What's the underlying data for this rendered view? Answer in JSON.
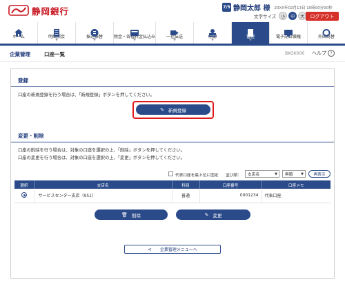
{
  "header": {
    "bank_name": "静岡銀行",
    "user_icon": "7/5",
    "user_name": "静岡太郎 様",
    "login_time": "20XX年02月13日 10時00分00秒",
    "font_size_label": "文字サイズ",
    "font_sizes": [
      "小",
      "中",
      "大"
    ],
    "logout_label": "ログアウト"
  },
  "nav": {
    "items": [
      {
        "label": "ホーム",
        "icon": "home-icon"
      },
      {
        "label": "明細照会",
        "icon": "statement-icon"
      },
      {
        "label": "振込振替",
        "icon": "transfer-icon"
      },
      {
        "label": "税金・各種料金払込み",
        "icon": "tax-payment-icon"
      },
      {
        "label": "一括伝送",
        "icon": "batch-transmission-icon"
      },
      {
        "label": "承認",
        "icon": "approval-icon"
      },
      {
        "label": "管理",
        "icon": "admin-icon"
      },
      {
        "label": "電子記録債権",
        "icon": "electronic-receivables-icon"
      },
      {
        "label": "外国為替",
        "icon": "foreign-exchange-icon"
      }
    ],
    "active_index": 6
  },
  "subheader": {
    "section": "企業管理",
    "page": "口座一覧",
    "screen_id": "BKGK006",
    "help_label": "ヘルプ"
  },
  "register": {
    "title": "登録",
    "description": "口座の新規登録を行う場合は、「新規登録」ボタンを押してください。",
    "new_button": "新規登録"
  },
  "edit": {
    "title": "変更・削除",
    "description_1": "口座の削除を行う場合は、対象の口座を選択の上、「削除」ボタンを押してください。",
    "description_2": "口座の変更を行う場合は、対象の口座を選択の上、「変更」ボタンを押してください。",
    "pin_label": "代表口座を最上位に固定",
    "sort_label": "並び順：",
    "sort_field": "支店名",
    "sort_order": "昇順",
    "redisplay_label": "再表示",
    "columns": [
      "選択",
      "支店名",
      "科目",
      "口座番号",
      "口座メモ"
    ],
    "rows": [
      {
        "branch": "サービスセンター支店（951）",
        "subject": "普通",
        "account_no": "0001234",
        "memo": "代表口座"
      }
    ],
    "delete_button": "削除",
    "change_button": "変更"
  },
  "footer": {
    "back_button": "企業管理メニューへ"
  },
  "colors": {
    "brand": "#2a4a8a",
    "bank_red": "#c8141e",
    "logout": "#d6302a",
    "highlight": "#e01818"
  }
}
